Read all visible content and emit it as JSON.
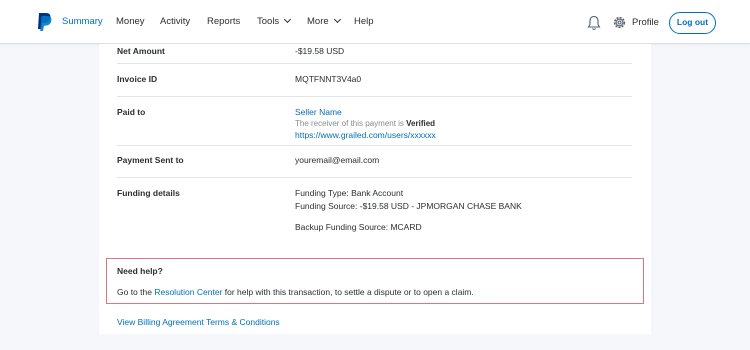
{
  "nav": {
    "items": [
      "Summary",
      "Money",
      "Activity",
      "Reports",
      "Tools",
      "More",
      "Help"
    ],
    "profile_label": "Profile",
    "logout_label": "Log out"
  },
  "details": {
    "net_amount": {
      "label": "Net Amount",
      "value": "-$19.58 USD"
    },
    "invoice_id": {
      "label": "Invoice ID",
      "value": "MQTFNNT3V4a0"
    },
    "paid_to": {
      "label": "Paid to",
      "seller_name": "Seller Name",
      "verified_prefix": "The receiver of this payment is ",
      "verified_word": "Verified",
      "url": "https://www.grailed.com/users/xxxxxx"
    },
    "payment_sent_to": {
      "label": "Payment Sent to",
      "value": "youremail@email.com"
    },
    "funding": {
      "label": "Funding details",
      "type": "Funding Type: Bank Account",
      "source": "Funding Source: -$19.58 USD - JPMORGAN CHASE BANK",
      "backup": "Backup Funding Source: MCARD"
    }
  },
  "help": {
    "title": "Need help?",
    "text_before": "Go to the ",
    "link": "Resolution Center",
    "text_after": " for help with this transaction, to settle a dispute or to open a claim."
  },
  "billing_link": "View Billing Agreement Terms & Conditions",
  "colors": {
    "brand": "#0070ba",
    "help_border": "#d9787e",
    "background": "#f5f7fa"
  },
  "icons": [
    "paypal-logo-icon",
    "chevron-down-icon",
    "bell-icon",
    "gear-icon"
  ]
}
